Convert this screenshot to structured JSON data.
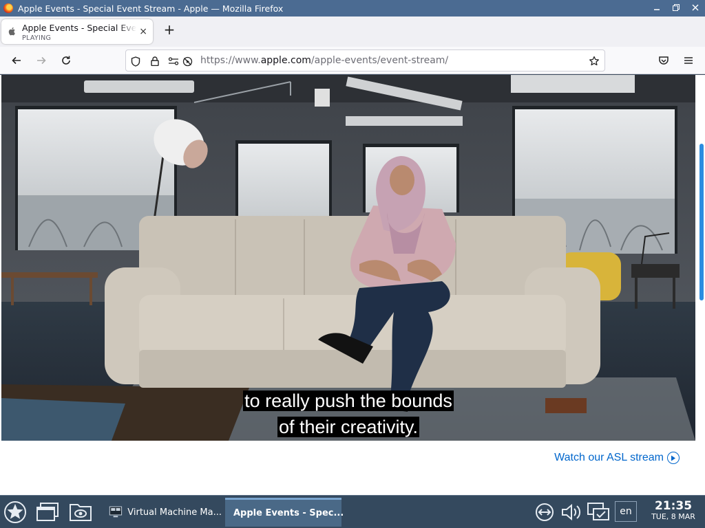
{
  "window": {
    "title": "Apple Events - Special Event Stream - Apple — Mozilla Firefox"
  },
  "tab": {
    "title": "Apple Events - Special Event Stream - Apple",
    "status": "PLAYING",
    "close": "×"
  },
  "newtab": {
    "label": "+"
  },
  "urlbar": {
    "prefix": "https://www.",
    "domain": "apple.com",
    "path": "/apple-events/event-stream/"
  },
  "video": {
    "caption_line1": "to really push the bounds",
    "caption_line2": "of their creativity."
  },
  "page": {
    "asl_link": "Watch our ASL stream"
  },
  "taskbar": {
    "tasks": [
      {
        "label": "Virtual Machine Ma..."
      },
      {
        "label": "Apple Events - Spec..."
      }
    ],
    "language": "en",
    "time": "21:35",
    "date": "TUE, 8 MAR"
  },
  "colors": {
    "titlebar": "#4b6b92",
    "taskbar": "#34495e",
    "link": "#0066cc",
    "scrollbar": "#2c8de0"
  }
}
